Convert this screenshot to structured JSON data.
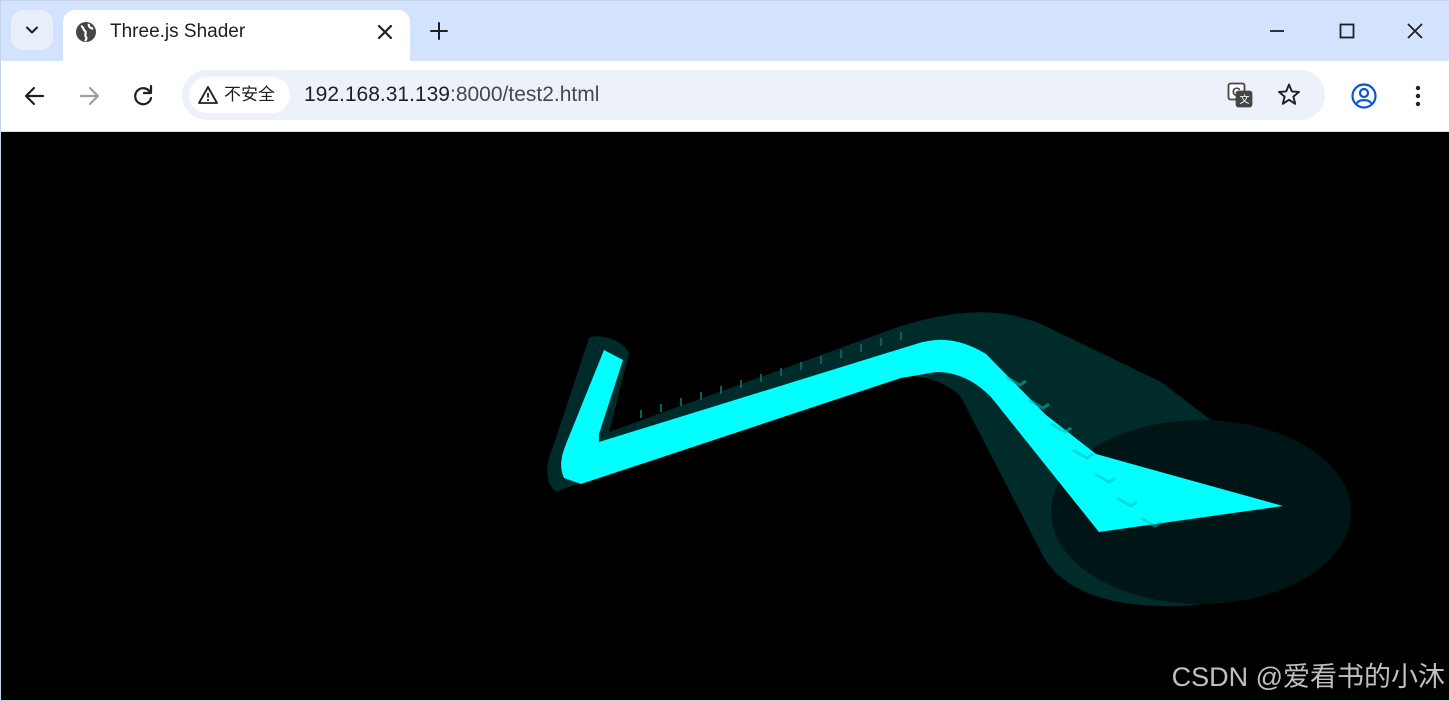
{
  "browser": {
    "tab": {
      "title": "Three.js Shader",
      "favicon": "globe-icon"
    },
    "window_controls": [
      "minimize-icon",
      "maximize-icon",
      "close-icon"
    ]
  },
  "toolbar": {
    "nav": [
      "back-arrow-icon",
      "forward-arrow-icon",
      "reload-icon"
    ],
    "security_label": "不安全",
    "url_host": "192.168.31.139",
    "url_rest": ":8000/test2.html",
    "omnibox_icons": [
      "translate-icon",
      "bookmark-star-icon"
    ],
    "right_icons": [
      "profile-icon",
      "more-menu-icon"
    ]
  },
  "page": {
    "background": "#000000",
    "ribbon_color": "#00ffff",
    "glow_color": "#002a2a",
    "watermark": "CSDN @爱看书的小沐"
  },
  "colors": {
    "tabstrip": "#d3e3fd",
    "omnibox": "#edf2fa",
    "accent": "#0b57d0"
  }
}
